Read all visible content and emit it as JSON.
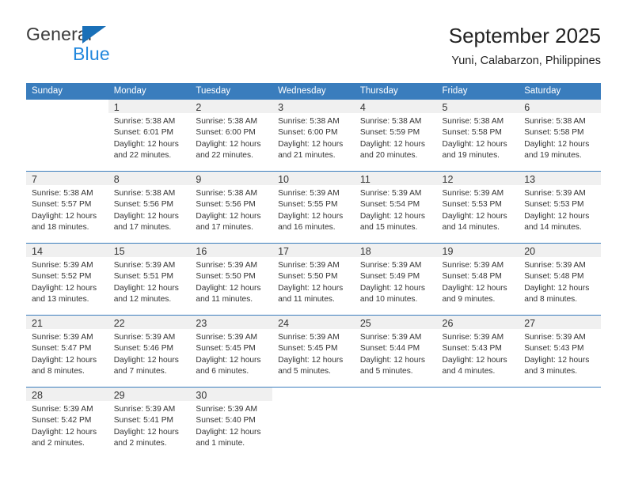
{
  "brand": {
    "name_top": "General",
    "name_bottom": "Blue",
    "triangle_color": "#1a70b8",
    "blue_text_color": "#2288dd",
    "gray_text_color": "#3a3a3a"
  },
  "header": {
    "title": "September 2025",
    "subtitle": "Yuni, Calabarzon, Philippines"
  },
  "theme": {
    "header_blue": "#3a7dbd",
    "daynum_band": "#f0f0f0",
    "text": "#333333"
  },
  "weekday_headers": [
    "Sunday",
    "Monday",
    "Tuesday",
    "Wednesday",
    "Thursday",
    "Friday",
    "Saturday"
  ],
  "weeks": [
    [
      {
        "day": "",
        "lines": []
      },
      {
        "day": "1",
        "lines": [
          "Sunrise: 5:38 AM",
          "Sunset: 6:01 PM",
          "Daylight: 12 hours",
          "and 22 minutes."
        ]
      },
      {
        "day": "2",
        "lines": [
          "Sunrise: 5:38 AM",
          "Sunset: 6:00 PM",
          "Daylight: 12 hours",
          "and 22 minutes."
        ]
      },
      {
        "day": "3",
        "lines": [
          "Sunrise: 5:38 AM",
          "Sunset: 6:00 PM",
          "Daylight: 12 hours",
          "and 21 minutes."
        ]
      },
      {
        "day": "4",
        "lines": [
          "Sunrise: 5:38 AM",
          "Sunset: 5:59 PM",
          "Daylight: 12 hours",
          "and 20 minutes."
        ]
      },
      {
        "day": "5",
        "lines": [
          "Sunrise: 5:38 AM",
          "Sunset: 5:58 PM",
          "Daylight: 12 hours",
          "and 19 minutes."
        ]
      },
      {
        "day": "6",
        "lines": [
          "Sunrise: 5:38 AM",
          "Sunset: 5:58 PM",
          "Daylight: 12 hours",
          "and 19 minutes."
        ]
      }
    ],
    [
      {
        "day": "7",
        "lines": [
          "Sunrise: 5:38 AM",
          "Sunset: 5:57 PM",
          "Daylight: 12 hours",
          "and 18 minutes."
        ]
      },
      {
        "day": "8",
        "lines": [
          "Sunrise: 5:38 AM",
          "Sunset: 5:56 PM",
          "Daylight: 12 hours",
          "and 17 minutes."
        ]
      },
      {
        "day": "9",
        "lines": [
          "Sunrise: 5:38 AM",
          "Sunset: 5:56 PM",
          "Daylight: 12 hours",
          "and 17 minutes."
        ]
      },
      {
        "day": "10",
        "lines": [
          "Sunrise: 5:39 AM",
          "Sunset: 5:55 PM",
          "Daylight: 12 hours",
          "and 16 minutes."
        ]
      },
      {
        "day": "11",
        "lines": [
          "Sunrise: 5:39 AM",
          "Sunset: 5:54 PM",
          "Daylight: 12 hours",
          "and 15 minutes."
        ]
      },
      {
        "day": "12",
        "lines": [
          "Sunrise: 5:39 AM",
          "Sunset: 5:53 PM",
          "Daylight: 12 hours",
          "and 14 minutes."
        ]
      },
      {
        "day": "13",
        "lines": [
          "Sunrise: 5:39 AM",
          "Sunset: 5:53 PM",
          "Daylight: 12 hours",
          "and 14 minutes."
        ]
      }
    ],
    [
      {
        "day": "14",
        "lines": [
          "Sunrise: 5:39 AM",
          "Sunset: 5:52 PM",
          "Daylight: 12 hours",
          "and 13 minutes."
        ]
      },
      {
        "day": "15",
        "lines": [
          "Sunrise: 5:39 AM",
          "Sunset: 5:51 PM",
          "Daylight: 12 hours",
          "and 12 minutes."
        ]
      },
      {
        "day": "16",
        "lines": [
          "Sunrise: 5:39 AM",
          "Sunset: 5:50 PM",
          "Daylight: 12 hours",
          "and 11 minutes."
        ]
      },
      {
        "day": "17",
        "lines": [
          "Sunrise: 5:39 AM",
          "Sunset: 5:50 PM",
          "Daylight: 12 hours",
          "and 11 minutes."
        ]
      },
      {
        "day": "18",
        "lines": [
          "Sunrise: 5:39 AM",
          "Sunset: 5:49 PM",
          "Daylight: 12 hours",
          "and 10 minutes."
        ]
      },
      {
        "day": "19",
        "lines": [
          "Sunrise: 5:39 AM",
          "Sunset: 5:48 PM",
          "Daylight: 12 hours",
          "and 9 minutes."
        ]
      },
      {
        "day": "20",
        "lines": [
          "Sunrise: 5:39 AM",
          "Sunset: 5:48 PM",
          "Daylight: 12 hours",
          "and 8 minutes."
        ]
      }
    ],
    [
      {
        "day": "21",
        "lines": [
          "Sunrise: 5:39 AM",
          "Sunset: 5:47 PM",
          "Daylight: 12 hours",
          "and 8 minutes."
        ]
      },
      {
        "day": "22",
        "lines": [
          "Sunrise: 5:39 AM",
          "Sunset: 5:46 PM",
          "Daylight: 12 hours",
          "and 7 minutes."
        ]
      },
      {
        "day": "23",
        "lines": [
          "Sunrise: 5:39 AM",
          "Sunset: 5:45 PM",
          "Daylight: 12 hours",
          "and 6 minutes."
        ]
      },
      {
        "day": "24",
        "lines": [
          "Sunrise: 5:39 AM",
          "Sunset: 5:45 PM",
          "Daylight: 12 hours",
          "and 5 minutes."
        ]
      },
      {
        "day": "25",
        "lines": [
          "Sunrise: 5:39 AM",
          "Sunset: 5:44 PM",
          "Daylight: 12 hours",
          "and 5 minutes."
        ]
      },
      {
        "day": "26",
        "lines": [
          "Sunrise: 5:39 AM",
          "Sunset: 5:43 PM",
          "Daylight: 12 hours",
          "and 4 minutes."
        ]
      },
      {
        "day": "27",
        "lines": [
          "Sunrise: 5:39 AM",
          "Sunset: 5:43 PM",
          "Daylight: 12 hours",
          "and 3 minutes."
        ]
      }
    ],
    [
      {
        "day": "28",
        "lines": [
          "Sunrise: 5:39 AM",
          "Sunset: 5:42 PM",
          "Daylight: 12 hours",
          "and 2 minutes."
        ]
      },
      {
        "day": "29",
        "lines": [
          "Sunrise: 5:39 AM",
          "Sunset: 5:41 PM",
          "Daylight: 12 hours",
          "and 2 minutes."
        ]
      },
      {
        "day": "30",
        "lines": [
          "Sunrise: 5:39 AM",
          "Sunset: 5:40 PM",
          "Daylight: 12 hours",
          "and 1 minute."
        ]
      },
      {
        "day": "",
        "lines": []
      },
      {
        "day": "",
        "lines": []
      },
      {
        "day": "",
        "lines": []
      },
      {
        "day": "",
        "lines": []
      }
    ]
  ]
}
